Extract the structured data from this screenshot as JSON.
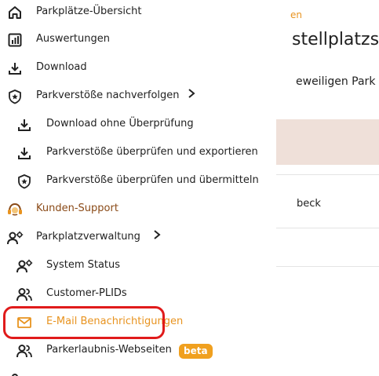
{
  "background": {
    "breadcrumb": "en",
    "heading": "stellplatzs",
    "description": "eweiligen Park",
    "row_text": "beck"
  },
  "menu": {
    "items": [
      {
        "label": "Parkplätze-Übersicht",
        "icon": "home-icon"
      },
      {
        "label": "Auswertungen",
        "icon": "bar-chart-icon"
      },
      {
        "label": "Download",
        "icon": "download-icon"
      },
      {
        "label": "Parkverstöße nachverfolgen",
        "icon": "shield-star-icon",
        "expanded_indicator": "chevron-right-icon"
      },
      {
        "label": "Download ohne Überprüfung",
        "icon": "download-icon"
      },
      {
        "label": "Parkverstöße überprüfen und exportieren",
        "icon": "download-icon"
      },
      {
        "label": "Parkverstöße überprüfen und übermitteln",
        "icon": "shield-star-icon"
      },
      {
        "label": "Kunden-Support",
        "icon": "headset-icon"
      },
      {
        "label": "Parkplatzverwaltung",
        "icon": "user-gear-icon",
        "expanded_indicator": "chevron-right-icon"
      },
      {
        "label": "System Status",
        "icon": "user-gear-icon"
      },
      {
        "label": "Customer-PLIDs",
        "icon": "users-icon"
      },
      {
        "label": "E-Mail Benachrichtigungen",
        "icon": "mail-icon",
        "active": true
      },
      {
        "label": "Parkerlaubnis-Webseiten",
        "icon": "users-icon",
        "badge": "beta"
      }
    ]
  },
  "colors": {
    "accent": "#e8931f",
    "support": "#8a4a17",
    "highlight_outline": "#e01b1b",
    "badge_bg": "#f0a01f"
  }
}
